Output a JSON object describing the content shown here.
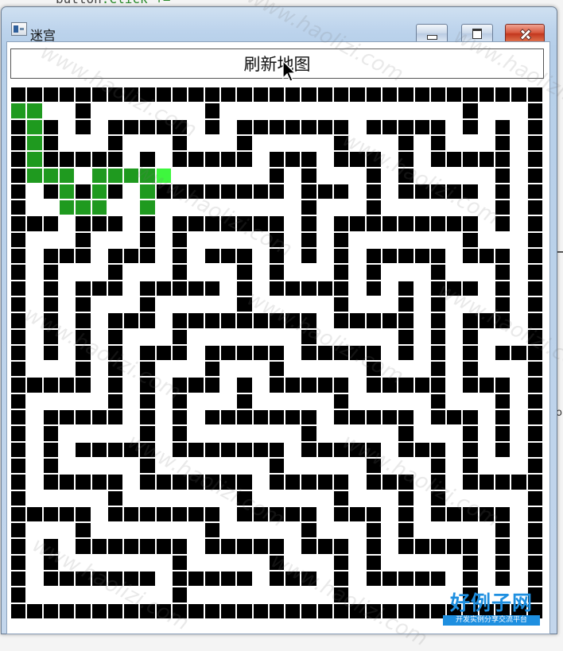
{
  "background": {
    "code_prefix": "button",
    "code_fragment": ".Click +="
  },
  "window": {
    "title": "迷宫",
    "icon": "app-icon",
    "controls": [
      "minimize-icon",
      "maximize-icon",
      "close-icon"
    ]
  },
  "toolbar": {
    "refresh_label": "刷新地图"
  },
  "maze": {
    "rows": 33,
    "cols": 33,
    "wall_color": "#000000",
    "open_color": "#ffffff",
    "path_color": "#1f9a1f",
    "current_color": "#3ef63e",
    "grid": [
      "#################################",
      "#...#.......#...............#...#",
      "#.#.#.#####.#.#######.#####.#.#.#",
      "#.#...#...#...#.....#...#.#...#.#",
      "#.#####.#.#####.###.###.#.#####.#",
      "#.#...#.#.......#.#...#.#.....#.#",
      "#.#.#.#.#########.###.#.#####.#.#",
      "#...#...#.........#...#.......#.#",
      "###.###.#.#######.#.#########.#.#",
      "#...#...#.#.....#.#.#.......#...#",
      "#.###.###.#.###.#.#.#.#####.###.#",
      "#.#...#...#...#.#...#.#...#...#.#",
      "#.#.###.#####.#.#####.#.#.###.#.#",
      "#.#.#...#.....#.....#...#.#...#.#",
      "#.#.#.###.#########.#####.#.###.#",
      "#.#.#.#...#.......#.....#.#.#...#",
      "#.#.#.#.###.#####.#####.#.#.#.###",
      "#...#.#.#...#...#.....#...#.#...#",
      "#####.#.#.###.#.#####.#####.###.#",
      "#.....#.#.#...#.....#.....#...#.#",
      "#.#####.#.#.#######.#####.###.#.#",
      "#.#.....#.#.......#.....#...#.#.#",
      "#.#.#####.#######.#####.###.#.#.#",
      "#.#.....#.......#.....#...#.#...#",
      "#.#####.#######.#####.###.#.#####",
      "#.....#.......#.....#...#.#.....#",
      "#####.#######.#####.###.#.#####.#",
      "#...#.......#.....#...#.#.....#.#",
      "#.#.#######.#####.###.#.#####.#.#",
      "#.#.......#.....#...#.#.....#.#.#",
      "#.#######.#####.###.#.#####.#.#.#",
      "#.........#.........#.......#...#",
      "#################################"
    ],
    "path": [
      [
        1,
        0
      ],
      [
        1,
        1
      ],
      [
        2,
        1
      ],
      [
        3,
        1
      ],
      [
        4,
        1
      ],
      [
        5,
        1
      ],
      [
        5,
        2
      ],
      [
        5,
        3
      ],
      [
        6,
        3
      ],
      [
        7,
        3
      ],
      [
        7,
        4
      ],
      [
        7,
        5
      ],
      [
        6,
        5
      ],
      [
        5,
        5
      ],
      [
        5,
        6
      ],
      [
        5,
        7
      ],
      [
        5,
        8
      ],
      [
        6,
        8
      ],
      [
        7,
        8
      ]
    ],
    "current": [
      5,
      9
    ]
  },
  "watermarks": [
    "www.haolizi.com"
  ],
  "logo": {
    "main": "好例子网",
    "sub": "开发实例分享交流平台"
  }
}
